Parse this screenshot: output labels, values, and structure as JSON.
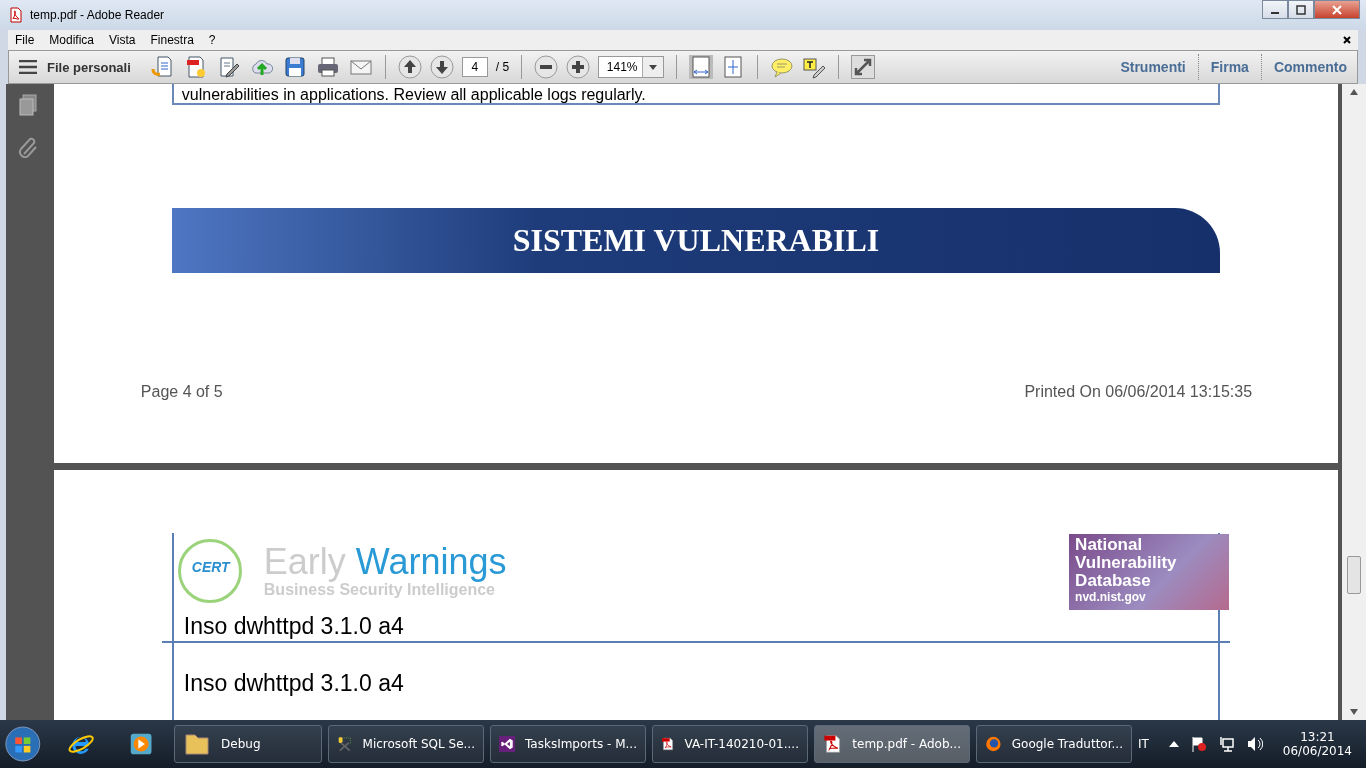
{
  "window": {
    "title": "temp.pdf - Adobe Reader"
  },
  "menu": {
    "items": [
      "File",
      "Modifica",
      "Vista",
      "Finestra",
      "?"
    ]
  },
  "toolbar": {
    "files_label": "File personali",
    "page_number": "4",
    "page_total": "/ 5",
    "zoom": "141%",
    "panels": [
      "Strumenti",
      "Firma",
      "Commento"
    ]
  },
  "document": {
    "page_a": {
      "text": "vulnerabilities in applications. Review all applicable logs regularly.",
      "banner": "SISTEMI VULNERABILI",
      "footer_left": "Page 4 of 5",
      "footer_right": "Printed On 06/06/2014 13:15:35"
    },
    "page_b": {
      "cert_logo": {
        "badge": "CERT",
        "name_a": "Early",
        "name_b": "Warnings",
        "tagline": "Business Security Intelligence"
      },
      "nvd_logo": [
        "National",
        "Vulnerability",
        "Database",
        "nvd.nist.gov"
      ],
      "rows": [
        "Inso dwhttpd 3.1.0 a4",
        "Inso dwhttpd 3.1.0 a4"
      ]
    }
  },
  "taskbar": {
    "buttons": [
      {
        "kind": "folder",
        "label": "Debug",
        "selected": false
      },
      {
        "kind": "sql",
        "label": "Microsoft SQL Se...",
        "selected": false
      },
      {
        "kind": "vs",
        "label": "TasksImports - M...",
        "selected": false
      },
      {
        "kind": "pdf",
        "label": "VA-IT-140210-01....",
        "selected": false
      },
      {
        "kind": "pdf",
        "label": "temp.pdf - Adob...",
        "selected": true
      },
      {
        "kind": "firefox",
        "label": "Google Traduttor...",
        "selected": false
      }
    ],
    "language": "IT",
    "time": "13:21",
    "date": "06/06/2014"
  }
}
